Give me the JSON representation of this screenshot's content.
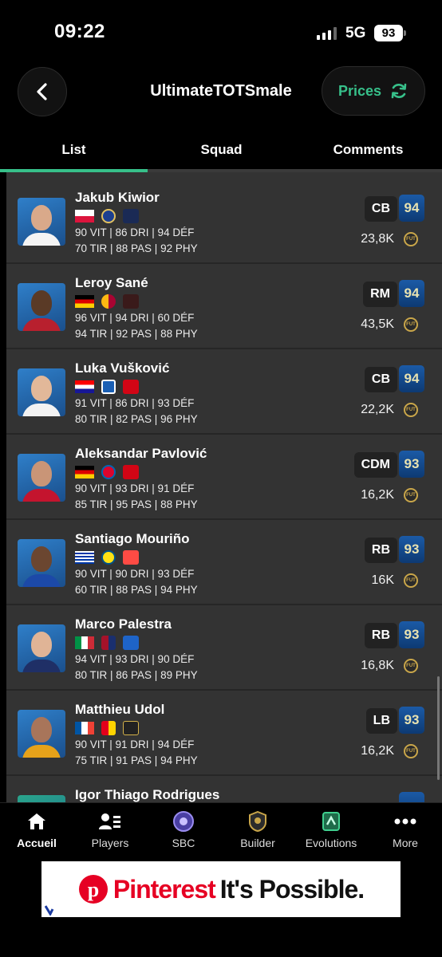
{
  "status_bar": {
    "time": "09:22",
    "network": "5G",
    "battery": "93"
  },
  "header": {
    "title": "UltimateTOTSmale",
    "prices_label": "Prices"
  },
  "tabs": [
    {
      "label": "List"
    },
    {
      "label": "Squad"
    },
    {
      "label": "Comments"
    }
  ],
  "players": [
    {
      "name": "Jakub Kiwior",
      "stats_line1": "90 VIT | 86 DRI | 94 DÉF",
      "stats_line2": "70 TIR | 88 PAS | 92 PHY",
      "position": "CB",
      "rating": "94",
      "price": "23,8K"
    },
    {
      "name": "Leroy Sané",
      "stats_line1": "96 VIT | 94 DRI | 60 DÉF",
      "stats_line2": "94 TIR | 92 PAS | 88 PHY",
      "position": "RM",
      "rating": "94",
      "price": "43,5K"
    },
    {
      "name": "Luka Vušković",
      "stats_line1": "91 VIT | 86 DRI | 93 DÉF",
      "stats_line2": "80 TIR | 82 PAS | 96 PHY",
      "position": "CB",
      "rating": "94",
      "price": "22,2K"
    },
    {
      "name": "Aleksandar Pavlović",
      "stats_line1": "90 VIT | 93 DRI | 91 DÉF",
      "stats_line2": "85 TIR | 95 PAS | 88 PHY",
      "position": "CDM",
      "rating": "93",
      "price": "16,2K"
    },
    {
      "name": "Santiago Mouriño",
      "stats_line1": "90 VIT | 90 DRI | 93 DÉF",
      "stats_line2": "60 TIR | 88 PAS | 94 PHY",
      "position": "RB",
      "rating": "93",
      "price": "16K"
    },
    {
      "name": "Marco Palestra",
      "stats_line1": "94 VIT | 93 DRI | 90 DÉF",
      "stats_line2": "80 TIR | 86 PAS | 89 PHY",
      "position": "RB",
      "rating": "93",
      "price": "16,8K"
    },
    {
      "name": "Matthieu Udol",
      "stats_line1": "90 VIT | 91 DRI | 94 DÉF",
      "stats_line2": "75 TIR | 91 PAS | 94 PHY",
      "position": "LB",
      "rating": "93",
      "price": "16,2K"
    },
    {
      "name": "Igor Thiago Rodrigues",
      "stats_line1": "",
      "stats_line2": "",
      "position": "",
      "rating": "",
      "price": ""
    }
  ],
  "bottom_nav": [
    {
      "label": "Accueil",
      "icon": "home-icon"
    },
    {
      "label": "Players",
      "icon": "players-icon"
    },
    {
      "label": "SBC",
      "icon": "sbc-icon"
    },
    {
      "label": "Builder",
      "icon": "builder-icon"
    },
    {
      "label": "Evolutions",
      "icon": "evolutions-icon"
    },
    {
      "label": "More",
      "icon": "more-icon"
    }
  ],
  "ad": {
    "brand": "Pinterest",
    "tagline": "It's Possible."
  },
  "colors": {
    "accent": "#37c08a",
    "rating_bg": "#1b5aa6",
    "list_bg": "#333333",
    "background": "#000000"
  }
}
